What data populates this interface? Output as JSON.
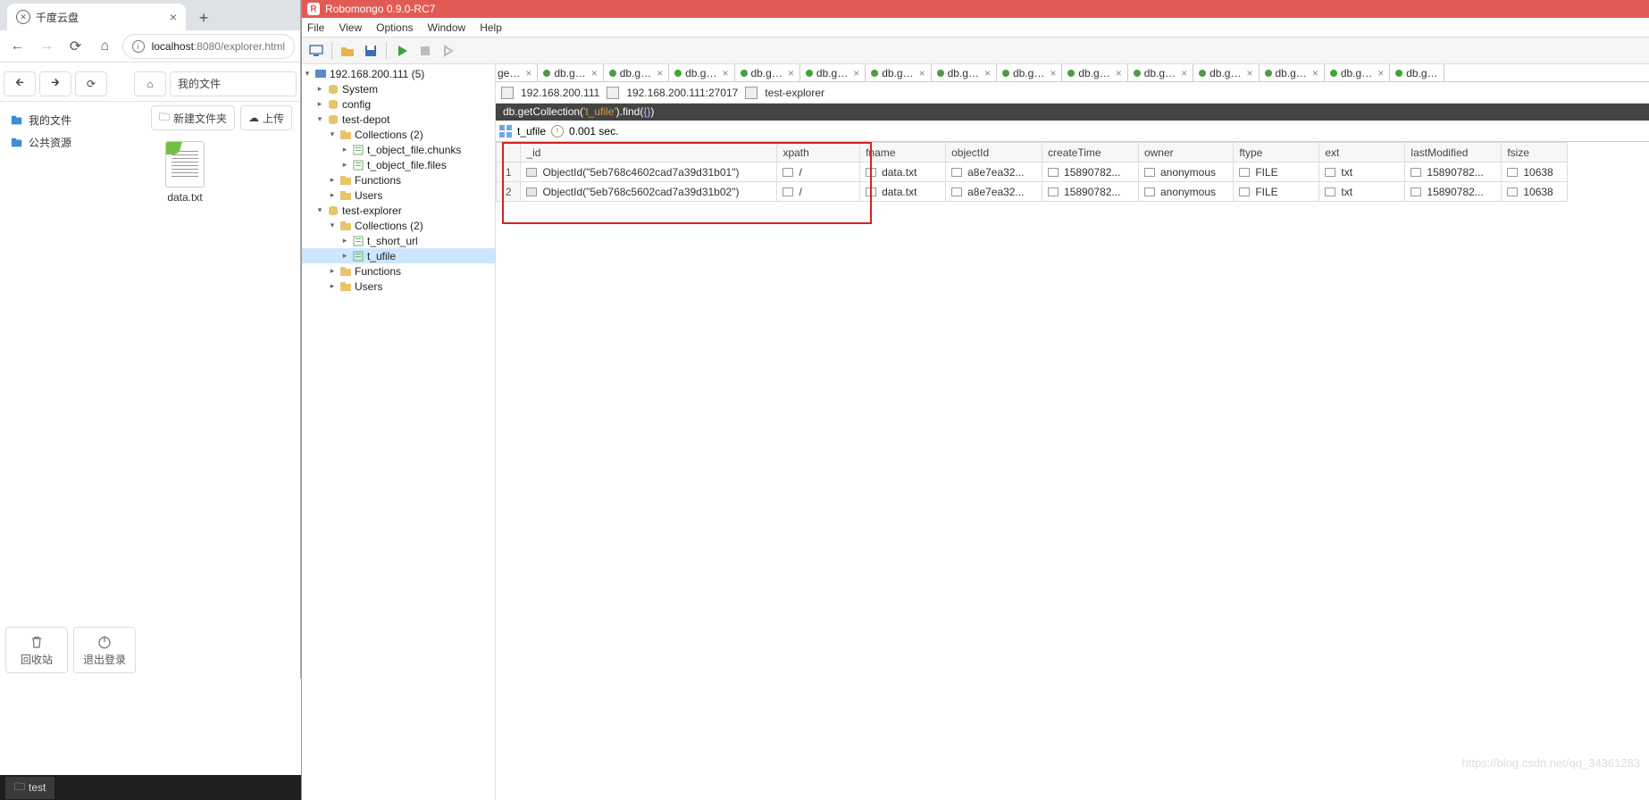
{
  "chrome": {
    "tab_title": "千度云盘",
    "url_host": "localhost",
    "url_port": ":8080",
    "url_path": "/explorer.html",
    "breadcrumb": "我的文件",
    "new_folder_btn": "新建文件夹",
    "upload_btn": "上传",
    "side": {
      "my_files": "我的文件",
      "public": "公共资源"
    },
    "file_name": "data.txt",
    "trash_label": "回收站",
    "logout_label": "退出登录"
  },
  "taskbar": {
    "item": "test"
  },
  "robo": {
    "title": "Robomongo 0.9.0-RC7",
    "menus": [
      "File",
      "View",
      "Options",
      "Window",
      "Help"
    ],
    "tree": {
      "server": "192.168.200.111 (5)",
      "system": "System",
      "config": "config",
      "depot": "test-depot",
      "collections": "Collections (2)",
      "chunks": "t_object_file.chunks",
      "files": "t_object_file.files",
      "functions": "Functions",
      "users": "Users",
      "explorer": "test-explorer",
      "tshort": "t_short_url",
      "tufile": "t_ufile"
    },
    "tab_label": "db.g…",
    "tab_label_cut": "ge…",
    "bc_host": "192.168.200.111",
    "bc_hostport": "192.168.200.111:27017",
    "bc_db": "test-explorer",
    "code_prefix": "db.getCollection(",
    "code_str": "'t_ufile'",
    "code_suffix": ").find(",
    "code_brace": "{}",
    "code_end": ")",
    "res_coll": "t_ufile",
    "res_time": "0.001 sec.",
    "cols": [
      "_id",
      "xpath",
      "fname",
      "objectId",
      "createTime",
      "owner",
      "ftype",
      "ext",
      "lastModified",
      "fsize"
    ],
    "rows": [
      {
        "n": "1",
        "id": "ObjectId(\"5eb768c4602cad7a39d31b01\")",
        "xpath": "/",
        "fname": "data.txt",
        "objectId": "a8e7ea32...",
        "createTime": "15890782...",
        "owner": "anonymous",
        "ftype": "FILE",
        "ext": "txt",
        "lastModified": "15890782...",
        "fsize": "10638"
      },
      {
        "n": "2",
        "id": "ObjectId(\"5eb768c5602cad7a39d31b02\")",
        "xpath": "/",
        "fname": "data.txt",
        "objectId": "a8e7ea32...",
        "createTime": "15890782...",
        "owner": "anonymous",
        "ftype": "FILE",
        "ext": "txt",
        "lastModified": "15890782...",
        "fsize": "10638"
      }
    ]
  },
  "watermark": "https://blog.csdn.net/qq_34361283"
}
